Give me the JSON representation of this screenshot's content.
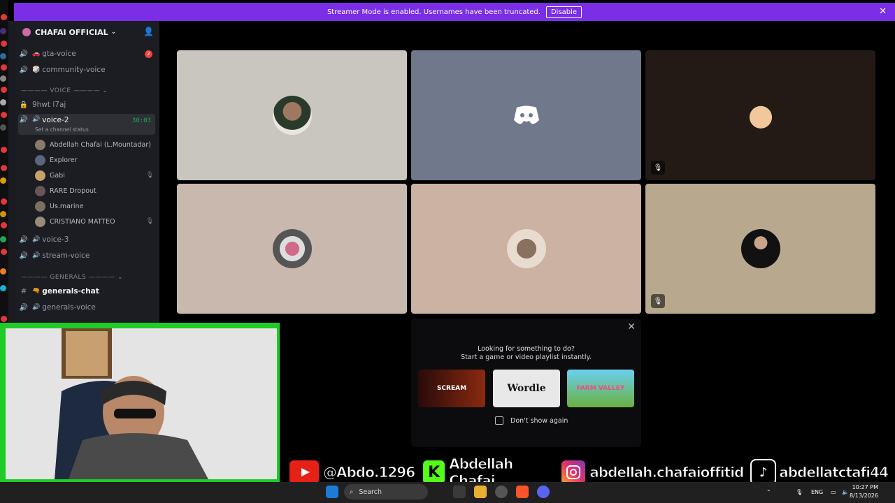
{
  "banner": {
    "message": "Streamer Mode is enabled. Usernames have been truncated.",
    "disable_label": "Disable"
  },
  "server": {
    "name": "CHAFAI OFFICIAL"
  },
  "channels": {
    "gta_voice": "gta-voice",
    "gta_badge": "2",
    "community_voice": "community-voice",
    "voice_category": "VOICE",
    "locked_channel": "9hwt l7aj",
    "voice_2": "voice-2",
    "voice_2_timer": "30:03",
    "voice_2_status": "Set a channel status",
    "voice_3": "voice-3",
    "stream_voice": "stream-voice",
    "generals_category": "GENERALS",
    "generals_chat": "generals-chat",
    "generals_voice": "generals-voice"
  },
  "members": [
    {
      "name": "Abdellah Chafai (L.Mountadar)",
      "muted": false
    },
    {
      "name": "Explorer",
      "muted": false
    },
    {
      "name": "Gabi",
      "muted": true
    },
    {
      "name": "RARE Dropout",
      "muted": false
    },
    {
      "name": "Us.marine",
      "muted": false
    },
    {
      "name": "CRISTIANO MATTEO",
      "muted": true
    }
  ],
  "popup": {
    "line1": "Looking for something to do?",
    "line2": "Start a game or video playlist instantly.",
    "games": [
      "SCREAM",
      "Wordle",
      "FARM VALLEY"
    ],
    "dont_show": "Don't show again"
  },
  "socials": {
    "youtube": "@Abdo.1296",
    "kick": "Abdellah Chafai",
    "instagram": "abdellah.chafaioffitid",
    "tiktok": "abdellatctafi44"
  },
  "taskbar": {
    "search": "Search",
    "lang": "ENG",
    "time": "10:27 PM",
    "date": "8/13/2026"
  },
  "colors": {
    "banner": "#7a2ee6",
    "sidebar": "#1c1d22",
    "webcam_frame": "#1ecb27"
  }
}
